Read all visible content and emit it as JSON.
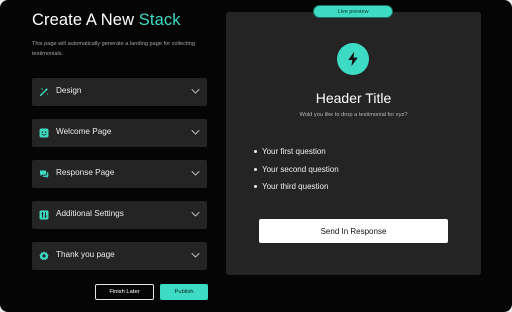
{
  "header": {
    "title_prefix": "Create A New ",
    "title_accent": "Stack",
    "subtitle": "This page will automatically generate a landing page for collecting testimonials."
  },
  "sections": [
    {
      "label": "Design",
      "icon": "magic-wand-icon"
    },
    {
      "label": "Welcome Page",
      "icon": "smiley-icon"
    },
    {
      "label": "Response Page",
      "icon": "chat-bubbles-icon"
    },
    {
      "label": "Additional Settings",
      "icon": "settings-panel-icon"
    },
    {
      "label": "Thank you page",
      "icon": "badge-icon"
    }
  ],
  "actions": {
    "finish_label": "Finish Later",
    "publish_label": "Publish"
  },
  "preview": {
    "badge": "Live preview",
    "title": "Header Title",
    "subtitle": "Wold you like to drop a testimonial for xyz?",
    "questions": [
      "Your first question",
      "Your second question",
      "Your third question"
    ],
    "send_label": "Send In Response",
    "logo_icon": "lightning-bolt-icon"
  },
  "colors": {
    "accent": "#3ddbc4",
    "background": "#050505",
    "panel": "#242424"
  }
}
